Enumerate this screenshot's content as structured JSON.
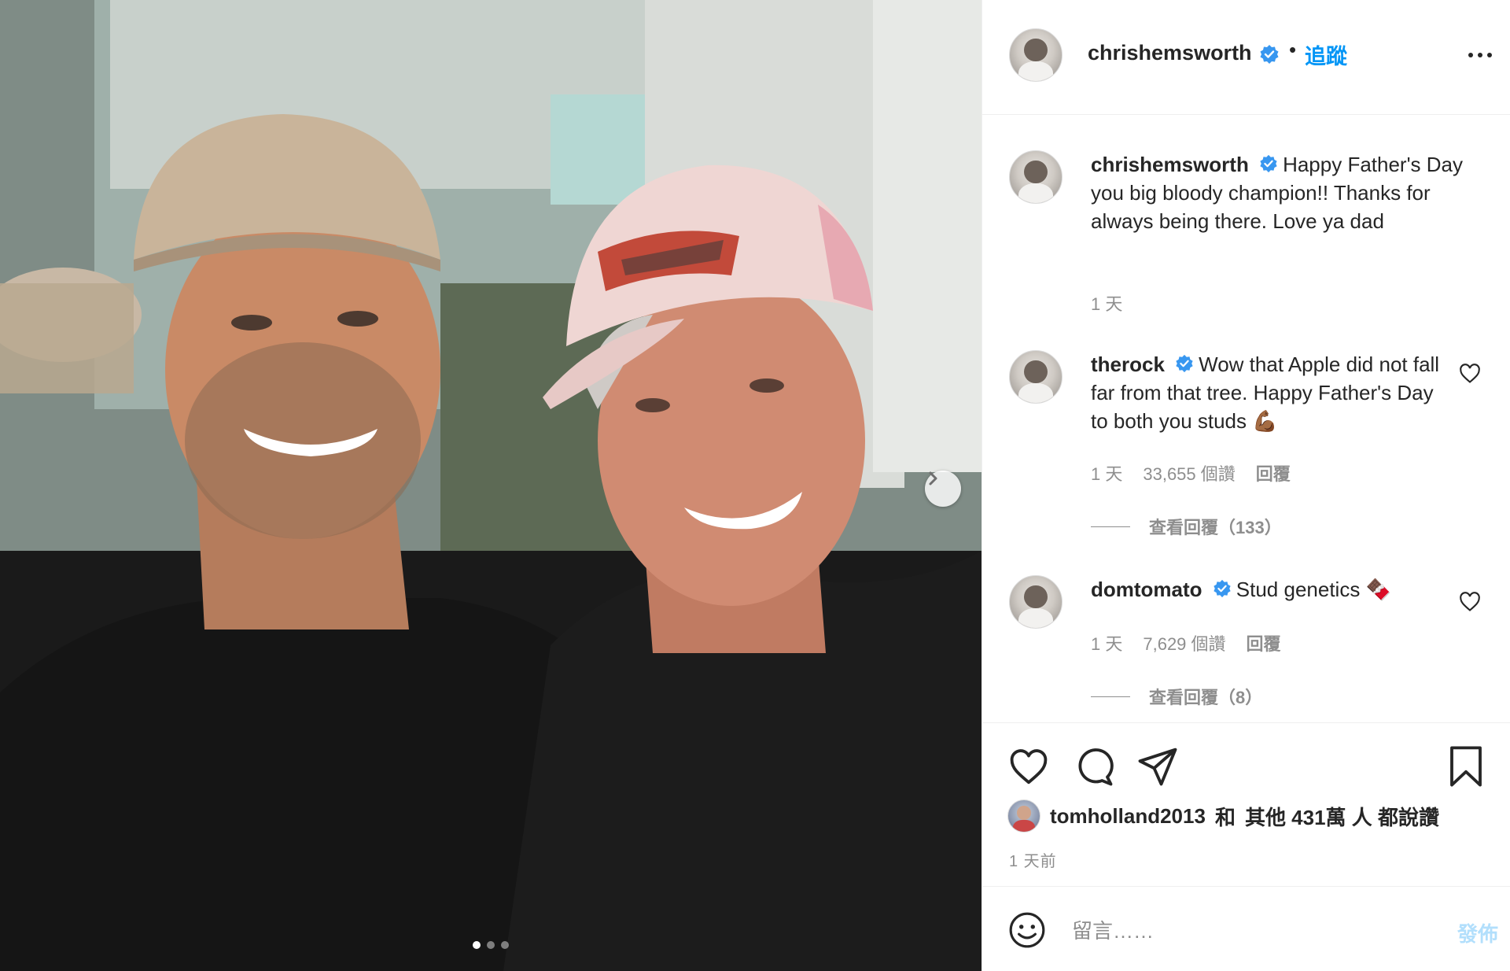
{
  "header": {
    "username": "chrishemsworth",
    "follow_label": "追蹤"
  },
  "caption": {
    "username": "chrishemsworth",
    "text": "Happy Father's Day you big bloody champion!! Thanks for always being there. Love ya dad",
    "time": "1 天"
  },
  "comments": [
    {
      "username": "therock",
      "text": "Wow that Apple did not fall far from that tree. Happy Father's Day to both you studs 💪🏾",
      "time": "1 天",
      "likes": "33,655 個讚",
      "reply_label": "回覆",
      "view_replies": "查看回覆（133）"
    },
    {
      "username": "domtomato",
      "text": "Stud genetics 🍫",
      "time": "1 天",
      "likes": "7,629 個讚",
      "reply_label": "回覆",
      "view_replies": "查看回覆（8）"
    }
  ],
  "likes_summary": {
    "username": "tomholland2013",
    "and": "和",
    "rest": "其他 431萬 人 都說讚"
  },
  "timestamp": "1 天前",
  "comment_box": {
    "placeholder": "留言……",
    "post_label": "發佈"
  },
  "carousel": {
    "current_slide": 1,
    "total_slides": 3
  },
  "colors": {
    "accent": "#0095f6",
    "verified": "#3897f0",
    "text": "#262626",
    "muted": "#8e8e8e"
  },
  "icons": [
    "next-arrow-icon",
    "more-options-icon",
    "verified-badge-icon",
    "heart-icon",
    "comment-icon",
    "share-icon",
    "bookmark-icon",
    "emoji-icon"
  ]
}
